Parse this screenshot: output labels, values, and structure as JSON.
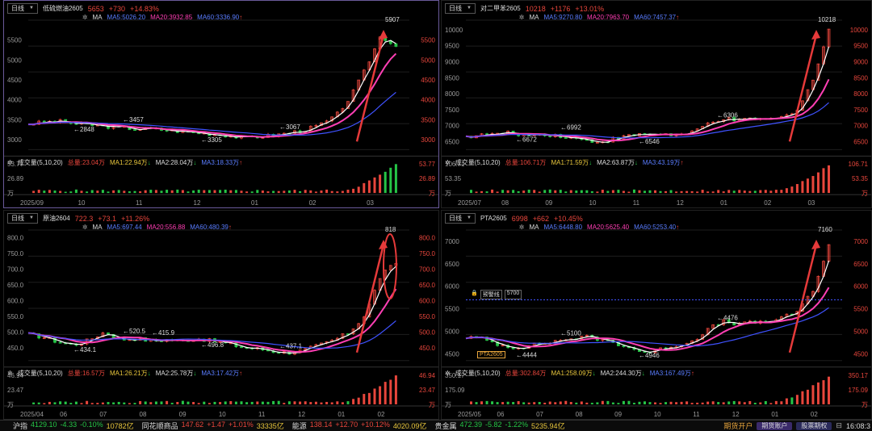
{
  "colors": {
    "up": "#e8463c",
    "down": "#26c547",
    "ma1": "#ffffff",
    "ma2": "#ff3fb4",
    "ma3": "#3f52ff",
    "grid": "#1e1e1e",
    "axis": "#e8463c"
  },
  "panels": [
    {
      "id": "p1",
      "period": "日线",
      "symbol": "低硫燃油2605",
      "price": "5653",
      "change": "+730",
      "pct": "+14.83%",
      "ma": {
        "ma5": "MA5:5026.20",
        "ma20": "MA20:3932.85",
        "ma60": "MA60:3336.90"
      },
      "vol": {
        "title": "成交量(5,10,20)",
        "total": "总量:23.04万",
        "m1": "MA1:22.94万",
        "m2": "MA2:28.04万",
        "m3": "MA3:18.33万"
      },
      "yticks": [
        "5500",
        "5000",
        "4500",
        "4000",
        "3500",
        "3000"
      ],
      "vticks": [
        "53.77",
        "26.89",
        "万"
      ],
      "xticks": [
        "2025/09",
        "10",
        "11",
        "12",
        "01",
        "02",
        "03"
      ],
      "annotations": [
        "5907",
        "3457",
        "3305",
        "3067",
        "2848"
      ],
      "ylim": [
        2750,
        6000
      ],
      "vmax": 53.77
    },
    {
      "id": "p2",
      "period": "日线",
      "symbol": "对二甲苯2605",
      "price": "10218",
      "change": "+1176",
      "pct": "+13.01%",
      "ma": {
        "ma5": "MA5:9270.80",
        "ma20": "MA20:7963.70",
        "ma60": "MA60:7457.37"
      },
      "vol": {
        "title": "成交量(5,10,20)",
        "total": "总量:106.71万",
        "m1": "MA1:71.59万",
        "m2": "MA2:63.87万",
        "m3": "MA3:43.19万"
      },
      "yticks": [
        "10000",
        "9500",
        "9000",
        "8500",
        "8000",
        "7500",
        "7000",
        "6500"
      ],
      "vticks": [
        "106.71",
        "53.35",
        "万"
      ],
      "xticks": [
        "2025/07",
        "08",
        "09",
        "10",
        "11",
        "12",
        "01",
        "02",
        "03"
      ],
      "annotations": [
        "10218",
        "6992",
        "6546",
        "6306",
        "6672"
      ],
      "ylim": [
        6250,
        10300
      ],
      "vmax": 106.71
    },
    {
      "id": "p3",
      "period": "日线",
      "symbol": "原油2604",
      "price": "722.3",
      "change": "+73.1",
      "pct": "+11.26%",
      "ma": {
        "ma5": "MA5:697.44",
        "ma20": "MA20:556.88",
        "ma60": "MA60:480.39"
      },
      "vol": {
        "title": "成交量(5,10,20)",
        "total": "总量:16.57万",
        "m1": "MA1:26.21万",
        "m2": "MA2:25.78万",
        "m3": "MA3:17.42万"
      },
      "yticks": [
        "800.0",
        "750.0",
        "700.0",
        "650.0",
        "600.0",
        "550.0",
        "500.0",
        "450.0"
      ],
      "vticks": [
        "46.94",
        "23.47",
        "万"
      ],
      "xticks": [
        "2025/04",
        "06",
        "07",
        "08",
        "09",
        "10",
        "11",
        "12",
        "01",
        "02"
      ],
      "annotations": [
        "818",
        "520.5",
        "496.8",
        "437.1",
        "434.1",
        "415.9"
      ],
      "ylim": [
        410,
        825
      ],
      "vmax": 46.94
    },
    {
      "id": "p4",
      "period": "日线",
      "symbol": "PTA2605",
      "price": "6998",
      "change": "+662",
      "pct": "+10.45%",
      "ma": {
        "ma5": "MA5:6448.80",
        "ma20": "MA20:5625.40",
        "ma60": "MA60:5253.40"
      },
      "vol": {
        "title": "成交量(5,10,20)",
        "total": "总量:302.84万",
        "m1": "MA1:258.09万",
        "m2": "MA2:244.30万",
        "m3": "MA3:167.49万"
      },
      "yticks": [
        "7000",
        "6500",
        "6000",
        "5500",
        "5000",
        "4500"
      ],
      "vticks": [
        "350.17",
        "175.09",
        "万"
      ],
      "xticks": [
        "2025/05",
        "06",
        "07",
        "08",
        "09",
        "10",
        "11",
        "12",
        "01",
        "02"
      ],
      "annotations": [
        "7160",
        "5100",
        "4946",
        "4476",
        "4444"
      ],
      "order": {
        "label": "预警线",
        "value": "5700"
      },
      "tag": "PTA2605",
      "ylim": [
        4350,
        7250
      ],
      "vmax": 350.17
    }
  ],
  "footer": [
    {
      "name": "沪指",
      "val": "4129.10",
      "chg": "-4.33",
      "pct": "-0.10%",
      "amt": "10782亿",
      "dir": "down"
    },
    {
      "name": "同花顺商品",
      "val": "147.62",
      "chg": "+1.47",
      "pct": "+1.01%",
      "amt": "33335亿",
      "dir": "up"
    },
    {
      "name": "能源",
      "val": "138.14",
      "chg": "+12.70",
      "pct": "+10.12%",
      "amt": "4020.09亿",
      "dir": "up"
    },
    {
      "name": "贵金属",
      "val": "472.39",
      "chg": "-5.82",
      "pct": "-1.22%",
      "amt": "5235.94亿",
      "dir": "down"
    }
  ],
  "footer_right": {
    "open": "期货开户",
    "b1": "期货账户",
    "b2": "股票期权",
    "time": "16:08:3"
  }
}
